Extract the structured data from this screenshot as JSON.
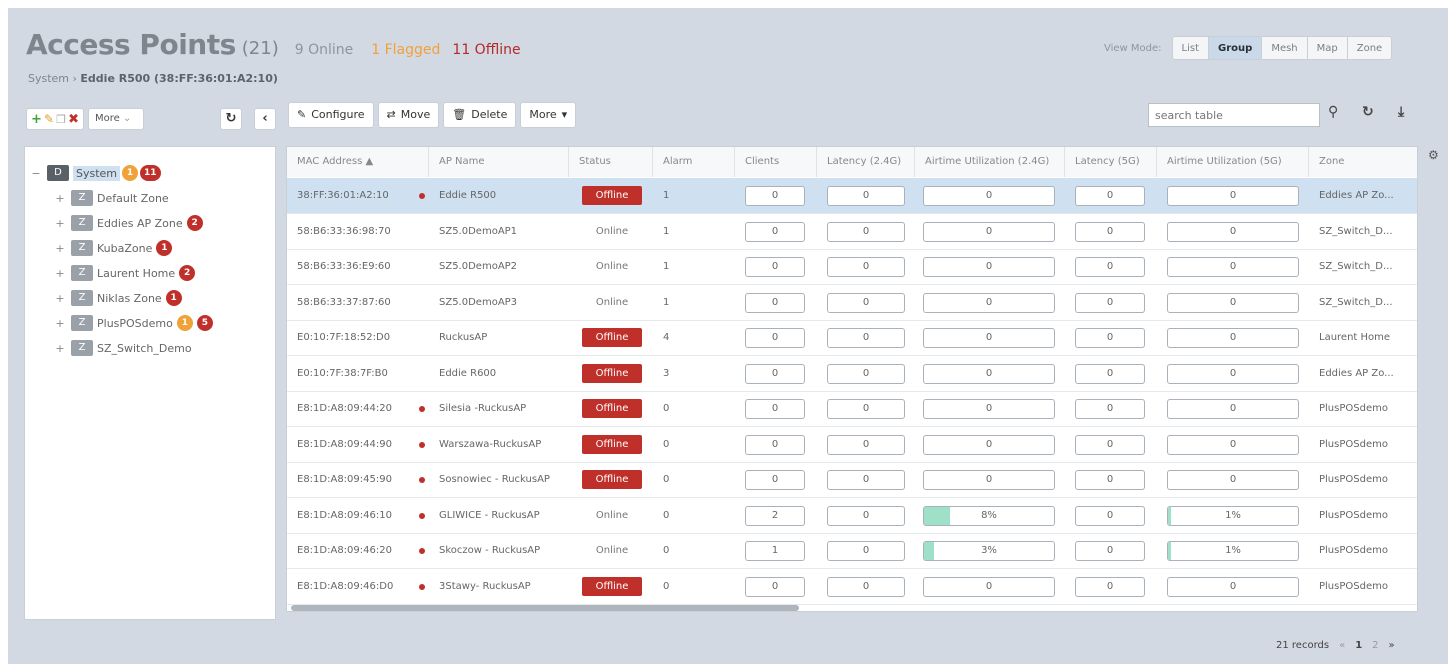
{
  "header": {
    "title": "Access Points",
    "count": "(21)",
    "online": "9 Online",
    "flagged": "1 Flagged",
    "offline": "11 Offline",
    "breadcrumb_prefix": "System ›",
    "breadcrumb_current": "Eddie R500 (38:FF:36:01:A2:10)"
  },
  "view_mode": {
    "label": "View Mode:",
    "options": [
      "List",
      "Group",
      "Mesh",
      "Map",
      "Zone"
    ],
    "active": "Group"
  },
  "left_toolbar": {
    "more_label": "More"
  },
  "toolbar": {
    "configure": "Configure",
    "move": "Move",
    "delete": "Delete",
    "more": "More"
  },
  "search": {
    "placeholder": "search table"
  },
  "tree": {
    "root": {
      "badge": "D",
      "label": "System",
      "flagged": "1",
      "offline": "11"
    },
    "zones": [
      {
        "badge": "Z",
        "label": "Default Zone",
        "counts": []
      },
      {
        "badge": "Z",
        "label": "Eddies AP Zone",
        "counts": [
          {
            "v": "2",
            "c": "red"
          }
        ]
      },
      {
        "badge": "Z",
        "label": "KubaZone",
        "counts": [
          {
            "v": "1",
            "c": "red"
          }
        ]
      },
      {
        "badge": "Z",
        "label": "Laurent Home",
        "counts": [
          {
            "v": "2",
            "c": "red"
          }
        ]
      },
      {
        "badge": "Z",
        "label": "Niklas Zone",
        "counts": [
          {
            "v": "1",
            "c": "red"
          }
        ]
      },
      {
        "badge": "Z",
        "label": "PlusPOSdemo",
        "counts": [
          {
            "v": "1",
            "c": "orange"
          },
          {
            "v": "5",
            "c": "red"
          }
        ]
      },
      {
        "badge": "Z",
        "label": "SZ_Switch_Demo",
        "counts": []
      }
    ]
  },
  "table": {
    "columns": [
      "MAC Address ▲",
      "AP Name",
      "Status",
      "Alarm",
      "Clients",
      "Latency (2.4G)",
      "Airtime Utilization (2.4G)",
      "Latency (5G)",
      "Airtime Utilization (5G)",
      "Zone"
    ],
    "rows": [
      {
        "mac": "38:FF:36:01:A2:10",
        "dot": true,
        "name": "Eddie R500",
        "status": "Offline",
        "alarm": "1",
        "clients": "0",
        "lat24": "0",
        "air24": "0",
        "air24_pct": 0,
        "lat5": "0",
        "air5": "0",
        "air5_pct": 0,
        "zone": "Eddies AP Zo...",
        "selected": true
      },
      {
        "mac": "58:B6:33:36:98:70",
        "dot": false,
        "name": "SZ5.0DemoAP1",
        "status": "Online",
        "alarm": "1",
        "clients": "0",
        "lat24": "0",
        "air24": "0",
        "air24_pct": 0,
        "lat5": "0",
        "air5": "0",
        "air5_pct": 0,
        "zone": "SZ_Switch_D...",
        "selected": false
      },
      {
        "mac": "58:B6:33:36:E9:60",
        "dot": false,
        "name": "SZ5.0DemoAP2",
        "status": "Online",
        "alarm": "1",
        "clients": "0",
        "lat24": "0",
        "air24": "0",
        "air24_pct": 0,
        "lat5": "0",
        "air5": "0",
        "air5_pct": 0,
        "zone": "SZ_Switch_D...",
        "selected": false
      },
      {
        "mac": "58:B6:33:37:87:60",
        "dot": false,
        "name": "SZ5.0DemoAP3",
        "status": "Online",
        "alarm": "1",
        "clients": "0",
        "lat24": "0",
        "air24": "0",
        "air24_pct": 0,
        "lat5": "0",
        "air5": "0",
        "air5_pct": 0,
        "zone": "SZ_Switch_D...",
        "selected": false
      },
      {
        "mac": "E0:10:7F:18:52:D0",
        "dot": false,
        "name": "RuckusAP",
        "status": "Offline",
        "alarm": "4",
        "clients": "0",
        "lat24": "0",
        "air24": "0",
        "air24_pct": 0,
        "lat5": "0",
        "air5": "0",
        "air5_pct": 0,
        "zone": "Laurent Home",
        "selected": false
      },
      {
        "mac": "E0:10:7F:38:7F:B0",
        "dot": false,
        "name": "Eddie R600",
        "status": "Offline",
        "alarm": "3",
        "clients": "0",
        "lat24": "0",
        "air24": "0",
        "air24_pct": 0,
        "lat5": "0",
        "air5": "0",
        "air5_pct": 0,
        "zone": "Eddies AP Zo...",
        "selected": false
      },
      {
        "mac": "E8:1D:A8:09:44:20",
        "dot": true,
        "name": "Silesia -RuckusAP",
        "status": "Offline",
        "alarm": "0",
        "clients": "0",
        "lat24": "0",
        "air24": "0",
        "air24_pct": 0,
        "lat5": "0",
        "air5": "0",
        "air5_pct": 0,
        "zone": "PlusPOSdemo",
        "selected": false
      },
      {
        "mac": "E8:1D:A8:09:44:90",
        "dot": true,
        "name": "Warszawa-RuckusAP",
        "status": "Offline",
        "alarm": "0",
        "clients": "0",
        "lat24": "0",
        "air24": "0",
        "air24_pct": 0,
        "lat5": "0",
        "air5": "0",
        "air5_pct": 0,
        "zone": "PlusPOSdemo",
        "selected": false
      },
      {
        "mac": "E8:1D:A8:09:45:90",
        "dot": true,
        "name": "Sosnowiec - RuckusAP",
        "status": "Offline",
        "alarm": "0",
        "clients": "0",
        "lat24": "0",
        "air24": "0",
        "air24_pct": 0,
        "lat5": "0",
        "air5": "0",
        "air5_pct": 0,
        "zone": "PlusPOSdemo",
        "selected": false
      },
      {
        "mac": "E8:1D:A8:09:46:10",
        "dot": true,
        "name": "GLIWICE - RuckusAP",
        "status": "Online",
        "alarm": "0",
        "clients": "2",
        "lat24": "0",
        "air24": "8%",
        "air24_pct": 8,
        "lat5": "0",
        "air5": "1%",
        "air5_pct": 1,
        "zone": "PlusPOSdemo",
        "selected": false
      },
      {
        "mac": "E8:1D:A8:09:46:20",
        "dot": true,
        "name": "Skoczow - RuckusAP",
        "status": "Online",
        "alarm": "0",
        "clients": "1",
        "lat24": "0",
        "air24": "3%",
        "air24_pct": 3,
        "lat5": "0",
        "air5": "1%",
        "air5_pct": 1,
        "zone": "PlusPOSdemo",
        "selected": false
      },
      {
        "mac": "E8:1D:A8:09:46:D0",
        "dot": true,
        "name": "3Stawy- RuckusAP",
        "status": "Offline",
        "alarm": "0",
        "clients": "0",
        "lat24": "0",
        "air24": "0",
        "air24_pct": 0,
        "lat5": "0",
        "air5": "0",
        "air5_pct": 0,
        "zone": "PlusPOSdemo",
        "selected": false
      }
    ]
  },
  "footer": {
    "records": "21 records",
    "prev": "«",
    "page_current": "1",
    "page_next": "2",
    "next": "»"
  }
}
